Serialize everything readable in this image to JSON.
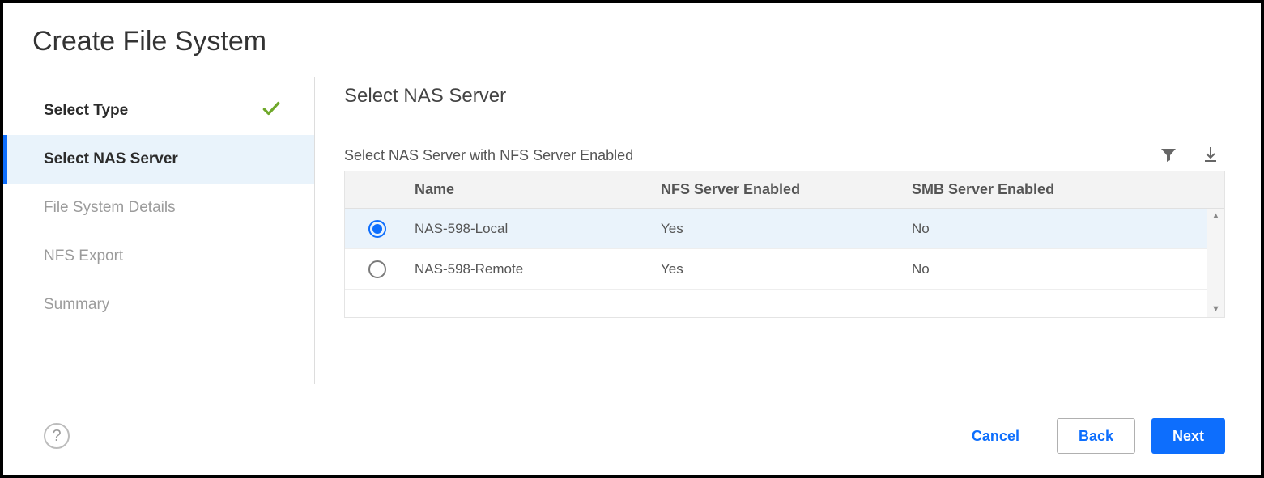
{
  "page": {
    "title": "Create File System"
  },
  "wizard": {
    "steps": [
      {
        "label": "Select Type",
        "state": "done"
      },
      {
        "label": "Select NAS Server",
        "state": "current"
      },
      {
        "label": "File System Details",
        "state": "pending"
      },
      {
        "label": "NFS Export",
        "state": "pending"
      },
      {
        "label": "Summary",
        "state": "pending"
      }
    ]
  },
  "panel": {
    "title": "Select NAS Server",
    "table_caption": "Select NAS Server with NFS Server Enabled",
    "columns": {
      "name": "Name",
      "nfs": "NFS Server Enabled",
      "smb": "SMB Server Enabled"
    },
    "rows": [
      {
        "name": "NAS-598-Local",
        "nfs": "Yes",
        "smb": "No",
        "selected": true
      },
      {
        "name": "NAS-598-Remote",
        "nfs": "Yes",
        "smb": "No",
        "selected": false
      }
    ]
  },
  "footer": {
    "cancel": "Cancel",
    "back": "Back",
    "next": "Next"
  },
  "icons": {
    "filter": "filter-icon",
    "download": "download-icon",
    "help": "help-icon",
    "check": "check-icon"
  }
}
